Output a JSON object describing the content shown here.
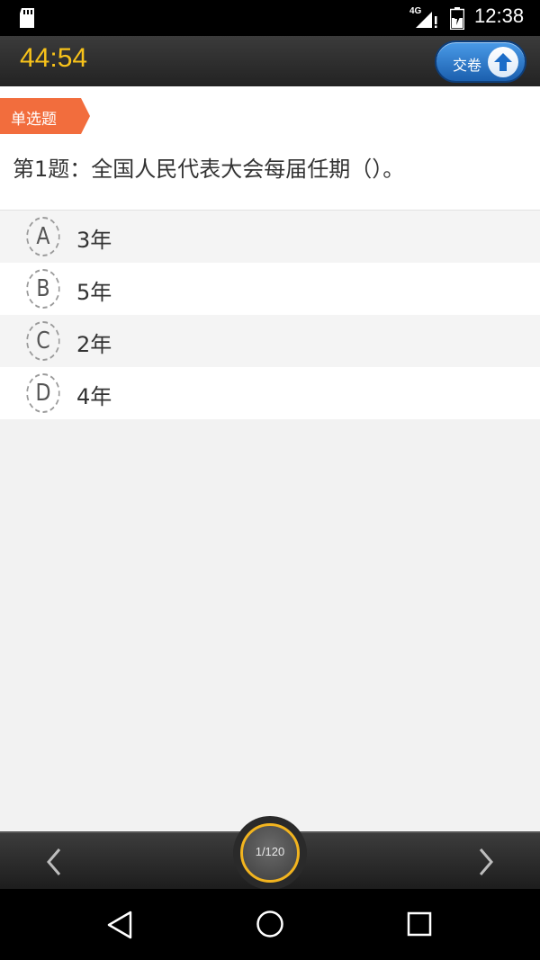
{
  "status_bar": {
    "network": "4G",
    "time": "12:38",
    "icons": [
      "sd-card-icon",
      "signal-icon",
      "battery-icon"
    ]
  },
  "header": {
    "timer": "44:54",
    "submit_label": "交卷",
    "submit_icon": "upload-arrow-icon"
  },
  "question": {
    "type_tag": "单选题",
    "text": "第1题：全国人民代表大会每届任期（）。"
  },
  "options": [
    {
      "letter": "A",
      "text": "3年"
    },
    {
      "letter": "B",
      "text": "5年"
    },
    {
      "letter": "C",
      "text": "2年"
    },
    {
      "letter": "D",
      "text": "4年"
    }
  ],
  "bottom_bar": {
    "page_counter": "1/120",
    "prev_icon": "chevron-left-icon",
    "next_icon": "chevron-right-icon"
  },
  "android_nav": {
    "icons": [
      "back-icon",
      "home-icon",
      "recent-apps-icon"
    ]
  },
  "colors": {
    "timer": "#f7c21a",
    "tag": "#f26d3d",
    "submit_button": "#2a78cf",
    "page_ring": "#f2b41f"
  }
}
